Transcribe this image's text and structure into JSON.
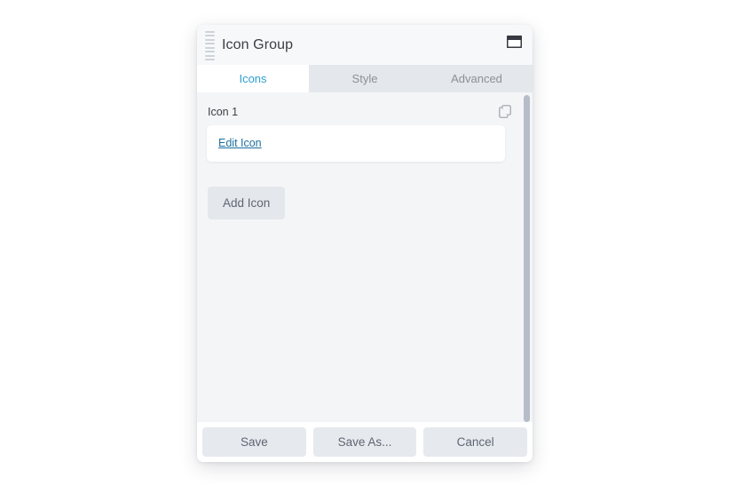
{
  "dialog": {
    "title": "Icon Group",
    "grip_icon": "drag-handle-icon",
    "window_icon": "window-icon"
  },
  "tabs": [
    {
      "label": "Icons",
      "active": true
    },
    {
      "label": "Style",
      "active": false
    },
    {
      "label": "Advanced",
      "active": false
    }
  ],
  "content": {
    "icon_item": {
      "label": "Icon 1",
      "duplicate_icon": "copy-icon",
      "edit_link": "Edit Icon"
    },
    "add_button": "Add Icon"
  },
  "footer": {
    "save": "Save",
    "save_as": "Save As...",
    "cancel": "Cancel"
  },
  "colors": {
    "accent": "#2f9fd0",
    "link": "#1f6f9e",
    "dialog_bg": "#f4f5f7",
    "tab_inactive_bg": "#e4e7eb",
    "button_bg": "#e6e9ee",
    "scroll_thumb": "#b6bcc8"
  }
}
